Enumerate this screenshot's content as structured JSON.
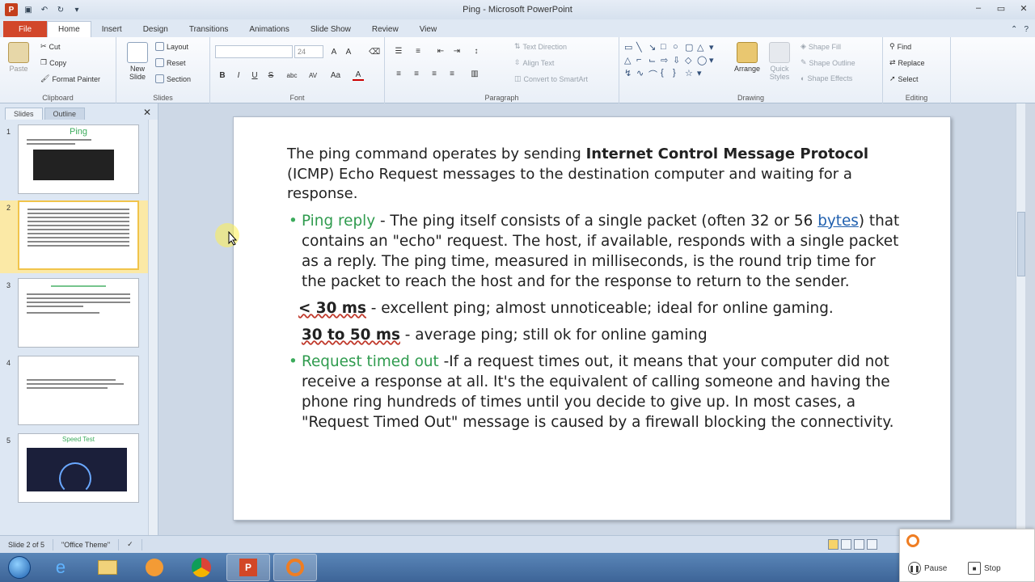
{
  "window": {
    "title": "Ping - Microsoft PowerPoint"
  },
  "qat": {
    "save": "save-icon",
    "undo": "undo-icon",
    "redo": "redo-icon"
  },
  "tabs": [
    "File",
    "Home",
    "Insert",
    "Design",
    "Transitions",
    "Animations",
    "Slide Show",
    "Review",
    "View"
  ],
  "ribbon": {
    "clipboard": {
      "label": "Clipboard",
      "paste": "Paste",
      "cut": "Cut",
      "copy": "Copy",
      "format_painter": "Format Painter"
    },
    "slides": {
      "label": "Slides",
      "new_slide": "New Slide",
      "layout": "Layout",
      "reset": "Reset",
      "section": "Section"
    },
    "font": {
      "label": "Font",
      "size": "24",
      "bold": "B",
      "italic": "I",
      "underline": "U",
      "strike": "S",
      "shadow": "abc",
      "spacing": "AV",
      "case": "Aa",
      "color": "A"
    },
    "paragraph": {
      "label": "Paragraph",
      "text_direction": "Text Direction",
      "align_text": "Align Text",
      "convert_smartart": "Convert to SmartArt"
    },
    "drawing": {
      "label": "Drawing",
      "arrange": "Arrange",
      "quick_styles": "Quick Styles",
      "shape_fill": "Shape Fill",
      "shape_outline": "Shape Outline",
      "shape_effects": "Shape Effects"
    },
    "editing": {
      "label": "Editing",
      "find": "Find",
      "replace": "Replace",
      "select": "Select"
    }
  },
  "left_pane": {
    "tabs": [
      "Slides",
      "Outline"
    ],
    "thumbnails": [
      {
        "num": "1",
        "title": "Ping"
      },
      {
        "num": "2",
        "title": ""
      },
      {
        "num": "3",
        "title": ""
      },
      {
        "num": "4",
        "title": ""
      },
      {
        "num": "5",
        "title": "Speed Test"
      }
    ]
  },
  "slide": {
    "intro_a": "The ping command operates by sending ",
    "intro_bold": "Internet Control Message Protocol",
    "intro_b": " (ICMP)  Echo Request messages to the destination computer and waiting for a response.",
    "bullet1_head": "Ping reply",
    "bullet1_a": " - The ping itself consists of a single packet (often 32 or 56 ",
    "bullet1_link": "bytes",
    "bullet1_b": ") that contains an \"echo\" request. The host, if available, responds with a single packet as a reply. The ping time, measured in milliseconds, is the round trip time for the packet to reach the host and for the response to return to the sender.",
    "sub1_bold": "< 30 ms",
    "sub1_text": " - excellent ping; almost unnoticeable; ideal for online gaming.",
    "sub2_bold": "30 to 50 ms",
    "sub2_text": " - average ping; still ok for online gaming",
    "bullet2_head": "Request timed out",
    "bullet2_text": " -If a request times out, it means that your computer did not receive a response at all. It's the equivalent of calling someone and having the phone ring hundreds of times until you decide to give up. In most cases, a \"Request Timed Out\" message is caused by a firewall blocking the connectivity."
  },
  "status": {
    "slide_info": "Slide 2 of 5",
    "theme": "\"Office Theme\""
  },
  "recorder": {
    "pause": "Pause",
    "stop": "Stop"
  },
  "colors": {
    "accent_green": "#2f9b4e",
    "file_tab": "#d2472a",
    "link_blue": "#1f5fae"
  }
}
